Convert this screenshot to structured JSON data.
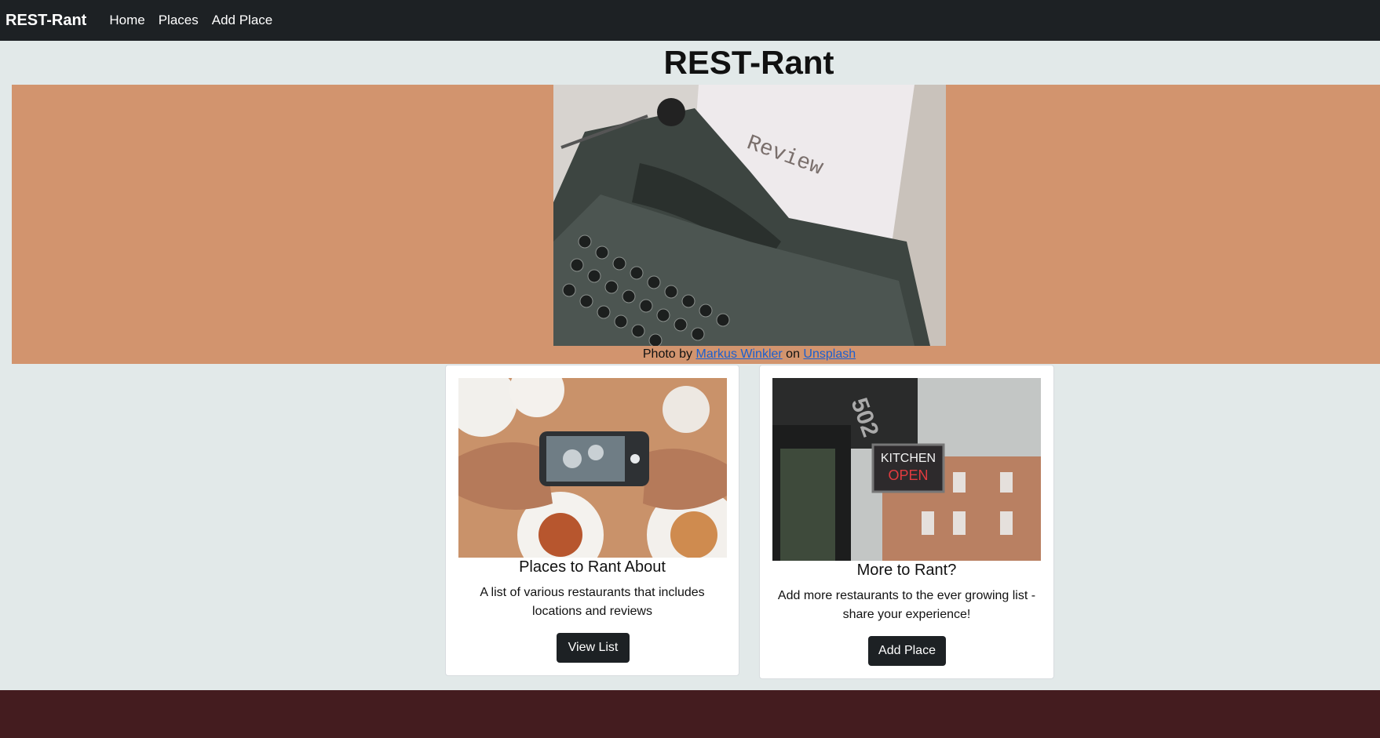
{
  "navbar": {
    "brand": "REST-Rant",
    "links": [
      "Home",
      "Places",
      "Add Place"
    ]
  },
  "page": {
    "title": "REST-Rant"
  },
  "hero": {
    "image_subject": "Typewriter with paper reading Review",
    "paper_text": "Review",
    "caption_prefix": "Photo by ",
    "caption_author": "Markus Winkler",
    "caption_middle": " on ",
    "caption_source": "Unsplash"
  },
  "cards": [
    {
      "image_subject": "Hands photographing food with a phone",
      "title": "Places to Rant About",
      "text": "A list of various restaurants that includes locations and reviews",
      "button": "View List"
    },
    {
      "image_subject": "Building with neon Kitchen Open sign",
      "title": "More to Rant?",
      "text": "Add more restaurants to the ever growing list - share your experience!",
      "button": "Add Place",
      "sign_number": "502",
      "sign_line1": "KITCHEN",
      "sign_line2": "OPEN"
    }
  ],
  "colors": {
    "navbar": "#1d2124",
    "background": "#e2e9e9",
    "hero": "#d2946e",
    "footer": "#441c1f",
    "link": "#1a5fd0"
  }
}
